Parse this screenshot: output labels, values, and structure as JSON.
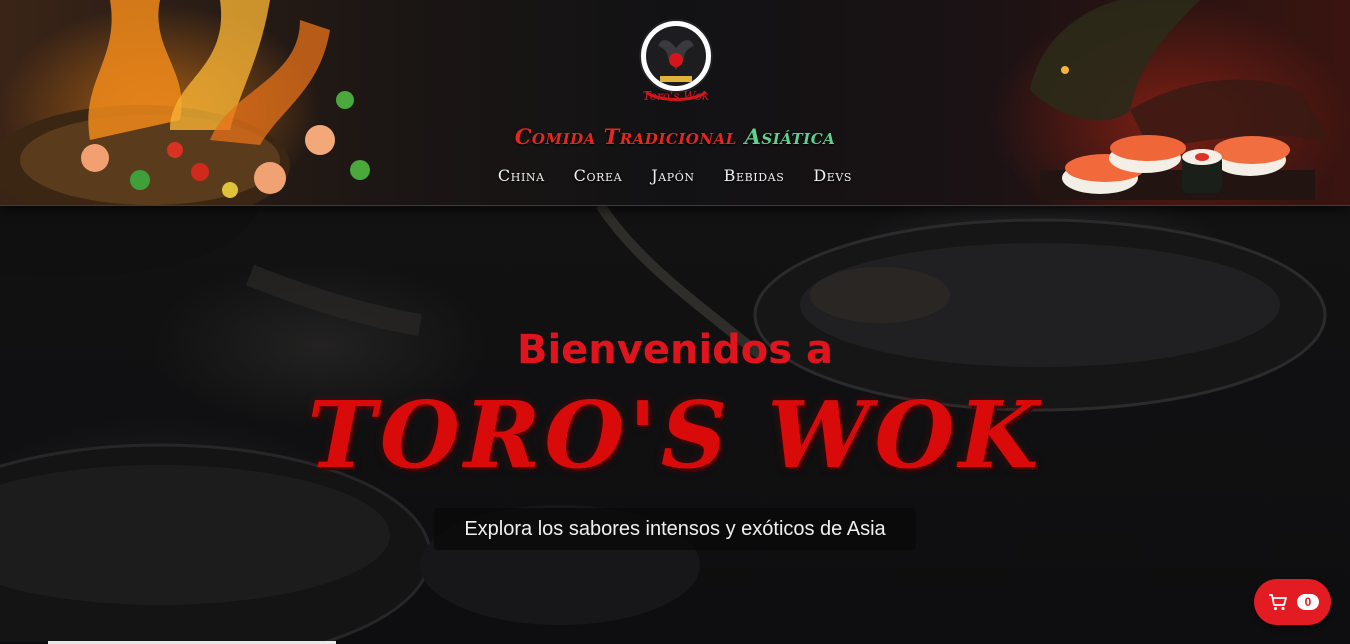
{
  "header": {
    "logo_text": "Toro's Wok",
    "tagline": {
      "part1": "Comida Tradicional",
      "part2": "Asiática"
    },
    "nav": [
      {
        "label": "China"
      },
      {
        "label": "Corea"
      },
      {
        "label": "Japón"
      },
      {
        "label": "Bebidas"
      },
      {
        "label": "Devs"
      }
    ]
  },
  "hero": {
    "welcome": "Bienvenidos a",
    "brand": "TORO'S WOK",
    "subtitle": "Explora los sabores intensos y exóticos de Asia"
  },
  "cart": {
    "count": "0"
  },
  "colors": {
    "accent_red": "#e31b23",
    "tagline_red": "#e8261f",
    "tagline_amber": "#e6b347",
    "tagline_green": "#5fd08e"
  },
  "icons": {
    "cart": "shopping-cart-icon",
    "logo": "bull-emblem"
  }
}
